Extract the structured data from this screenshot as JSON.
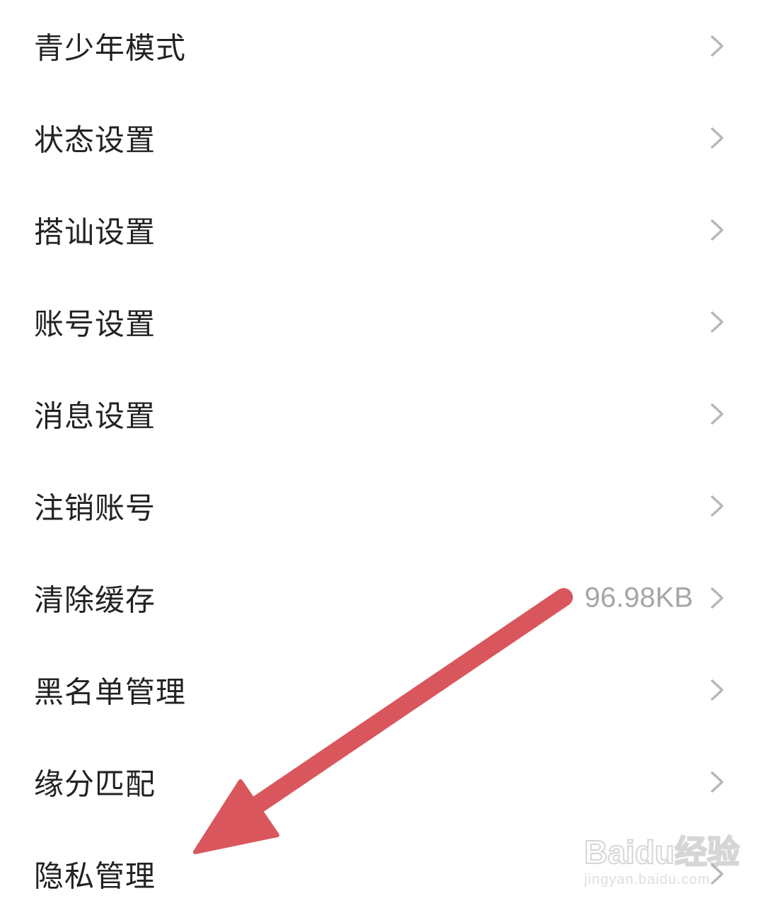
{
  "settings": {
    "items": [
      {
        "label": "青少年模式"
      },
      {
        "label": "状态设置"
      },
      {
        "label": "搭讪设置"
      },
      {
        "label": "账号设置"
      },
      {
        "label": "消息设置"
      },
      {
        "label": "注销账号"
      },
      {
        "label": "清除缓存",
        "value": "96.98KB"
      },
      {
        "label": "黑名单管理"
      },
      {
        "label": "缘分匹配"
      },
      {
        "label": "隐私管理"
      }
    ],
    "chevron_icon": "chevron-right-icon"
  },
  "annotation": {
    "arrow_color": "#d9565c",
    "arrow_icon": "pointer-arrow"
  },
  "watermark": {
    "logo_text": "Baidu经验",
    "url": "jingyan.baidu.com"
  },
  "colors": {
    "label_text": "#222222",
    "value_text": "#a6a6a6",
    "chevron": "#b8b8b8"
  }
}
